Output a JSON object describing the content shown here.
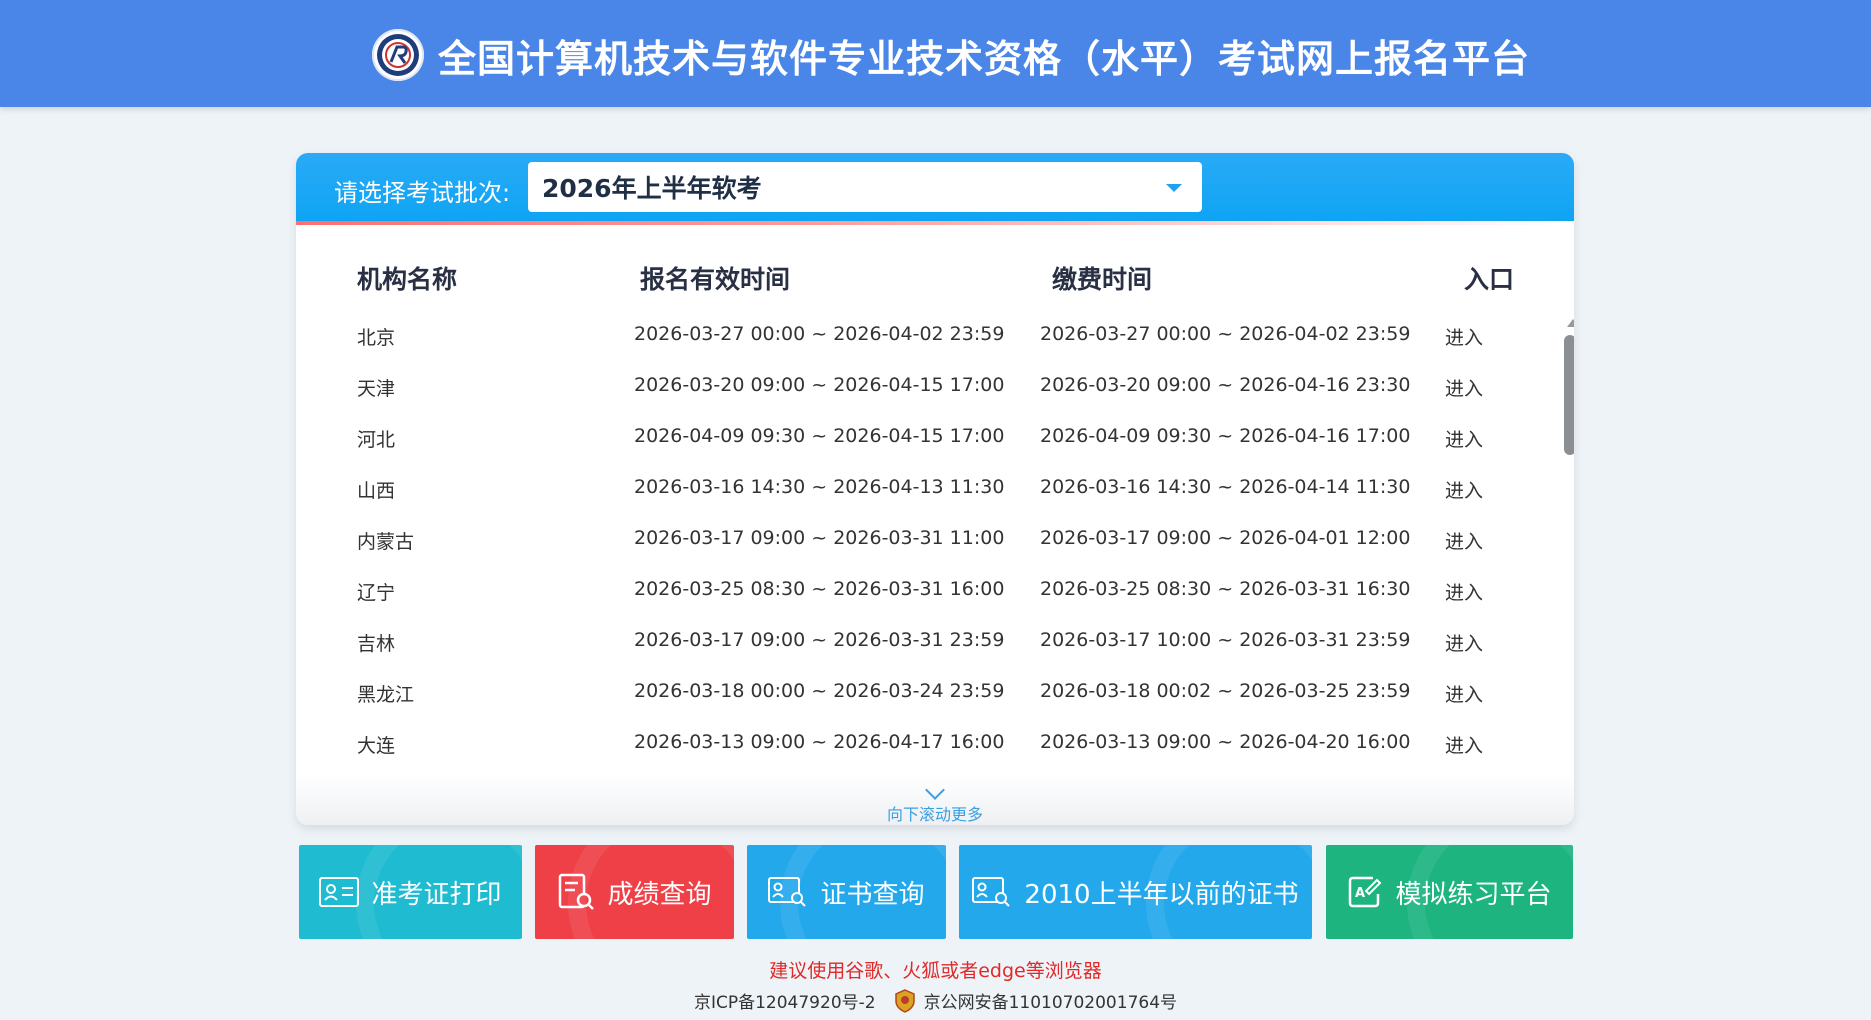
{
  "header": {
    "title": "全国计算机技术与软件专业技术资格（水平）考试网上报名平台"
  },
  "batch_select": {
    "label": "请选择考试批次:",
    "selected": "2026年上半年软考"
  },
  "table": {
    "columns": [
      "机构名称",
      "报名有效时间",
      "缴费时间",
      "入口"
    ],
    "rows": [
      {
        "org": "北京",
        "reg": "2026-03-27 00:00 ~ 2026-04-02 23:59",
        "pay": "2026-03-27 00:00 ~ 2026-04-02 23:59",
        "entry": "进入"
      },
      {
        "org": "天津",
        "reg": "2026-03-20 09:00 ~ 2026-04-15 17:00",
        "pay": "2026-03-20 09:00 ~ 2026-04-16 23:30",
        "entry": "进入"
      },
      {
        "org": "河北",
        "reg": "2026-04-09 09:30 ~ 2026-04-15 17:00",
        "pay": "2026-04-09 09:30 ~ 2026-04-16 17:00",
        "entry": "进入"
      },
      {
        "org": "山西",
        "reg": "2026-03-16 14:30 ~ 2026-04-13 11:30",
        "pay": "2026-03-16 14:30 ~ 2026-04-14 11:30",
        "entry": "进入"
      },
      {
        "org": "内蒙古",
        "reg": "2026-03-17 09:00 ~ 2026-03-31 11:00",
        "pay": "2026-03-17 09:00 ~ 2026-04-01 12:00",
        "entry": "进入"
      },
      {
        "org": "辽宁",
        "reg": "2026-03-25 08:30 ~ 2026-03-31 16:00",
        "pay": "2026-03-25 08:30 ~ 2026-03-31 16:30",
        "entry": "进入"
      },
      {
        "org": "吉林",
        "reg": "2026-03-17 09:00 ~ 2026-03-31 23:59",
        "pay": "2026-03-17 10:00 ~ 2026-03-31 23:59",
        "entry": "进入"
      },
      {
        "org": "黑龙江",
        "reg": "2026-03-18 00:00 ~ 2026-03-24 23:59",
        "pay": "2026-03-18 00:02 ~ 2026-03-25 23:59",
        "entry": "进入"
      },
      {
        "org": "大连",
        "reg": "2026-03-13 09:00 ~ 2026-04-17 16:00",
        "pay": "2026-03-13 09:00 ~ 2026-04-20 16:00",
        "entry": "进入"
      }
    ],
    "scroll_more": "向下滚动更多"
  },
  "buttons": [
    {
      "label": "准考证打印",
      "icon": "id-card-icon"
    },
    {
      "label": "成绩查询",
      "icon": "document-search-icon"
    },
    {
      "label": "证书查询",
      "icon": "certificate-search-icon"
    },
    {
      "label": "2010上半年以前的证书",
      "icon": "certificate-search-icon"
    },
    {
      "label": "模拟练习平台",
      "icon": "practice-edit-icon"
    }
  ],
  "footer": {
    "browser_tip": "建议使用谷歌、火狐或者edge等浏览器",
    "icp": "京ICP备12047920号-2",
    "police": "京公网安备11010702001764号"
  },
  "colors": {
    "header_bg": "#4a86e8",
    "panel_head": "#0ea4f4",
    "btn_teal": "#1fbbd0",
    "btn_red": "#ef3f47",
    "btn_blue": "#23a8ec",
    "btn_green": "#1db480",
    "warn_text": "#e02a2a"
  }
}
